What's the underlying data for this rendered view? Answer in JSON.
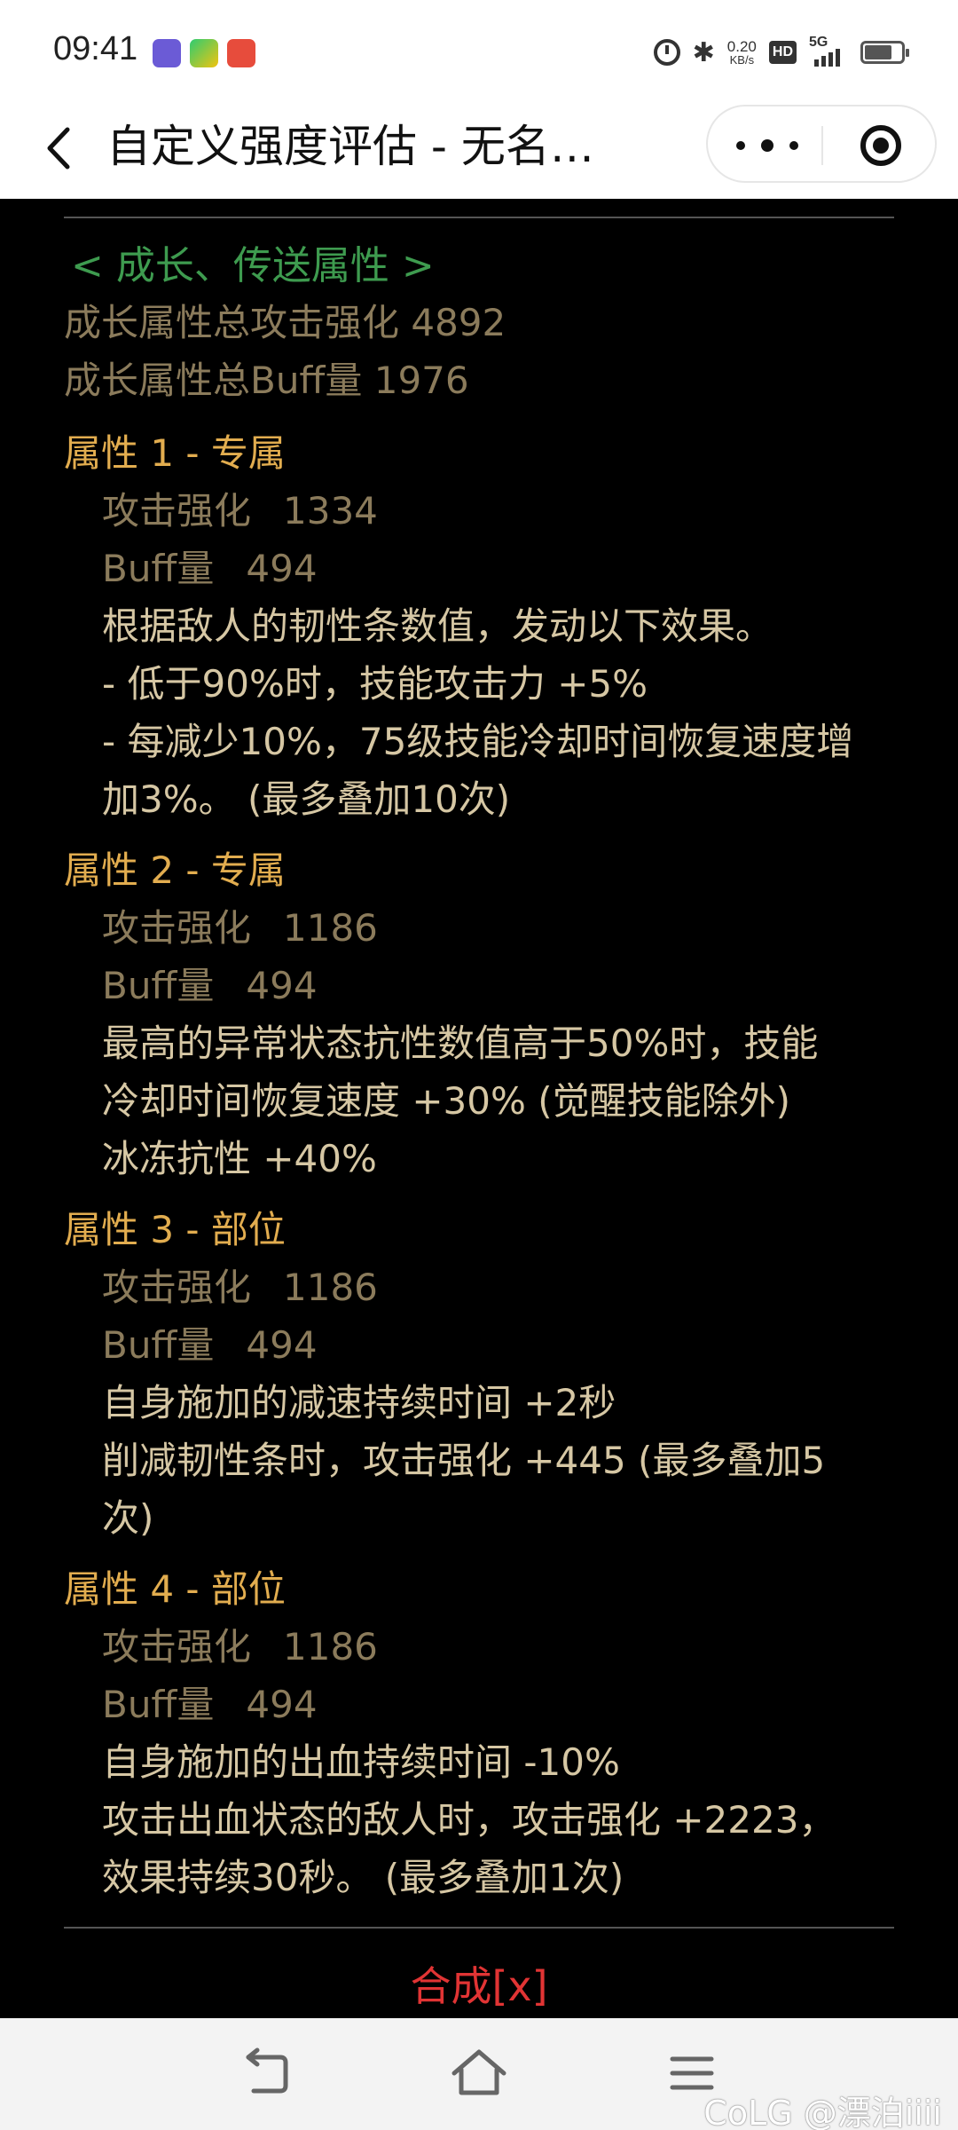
{
  "status_bar": {
    "time": "09:41",
    "network_speed_value": "0.20",
    "network_speed_unit": "KB/s",
    "hd_label": "HD",
    "signal_label": "5G",
    "icons": [
      "app-icon-blue",
      "app-icon-green",
      "app-icon-red",
      "alarm-icon",
      "bluetooth-icon",
      "signal-icon",
      "battery-icon"
    ]
  },
  "title_bar": {
    "title": "自定义强度评估 - 无名…"
  },
  "content": {
    "section_header": "< 成长、传送属性 >",
    "summary": [
      "成长属性总攻击强化 4892",
      "成长属性总Buff量 1976"
    ],
    "attributes": [
      {
        "title": "属性 1 - 专属",
        "attack_label": "攻击强化",
        "attack_value": "1334",
        "buff_label": "Buff量",
        "buff_value": "494",
        "effects": [
          "根据敌人的韧性条数值，发动以下效果。",
          "- 低于90%时，技能攻击力 +5%",
          "- 每减少10%，75级技能冷却时间恢复速度增",
          "加3%。 (最多叠加10次)"
        ]
      },
      {
        "title": "属性 2 - 专属",
        "attack_label": "攻击强化",
        "attack_value": "1186",
        "buff_label": "Buff量",
        "buff_value": "494",
        "effects": [
          "最高的异常状态抗性数值高于50%时，技能",
          "冷却时间恢复速度 +30% (觉醒技能除外)",
          "冰冻抗性 +40%"
        ]
      },
      {
        "title": "属性 3 - 部位",
        "attack_label": "攻击强化",
        "attack_value": "1186",
        "buff_label": "Buff量",
        "buff_value": "494",
        "effects": [
          "自身施加的减速持续时间 +2秒",
          "削减韧性条时，攻击强化 +445 (最多叠加5",
          "次)"
        ]
      },
      {
        "title": "属性 4 - 部位",
        "attack_label": "攻击强化",
        "attack_value": "1186",
        "buff_label": "Buff量",
        "buff_value": "494",
        "effects": [
          "自身施加的出血持续时间 -10%",
          "攻击出血状态的敌人时，攻击强化 +2223，",
          "效果持续30秒。 (最多叠加1次)"
        ]
      }
    ],
    "synth_button": "合成[x]"
  },
  "nav_bar": {
    "watermark": "CoLG @漂泊iiii"
  },
  "colors": {
    "green": "#3e9b4f",
    "gray_text": "#8b7b5b",
    "gold": "#e2ad4f",
    "light_text": "#d6c7a4",
    "red": "#e13434",
    "background": "#000000"
  }
}
